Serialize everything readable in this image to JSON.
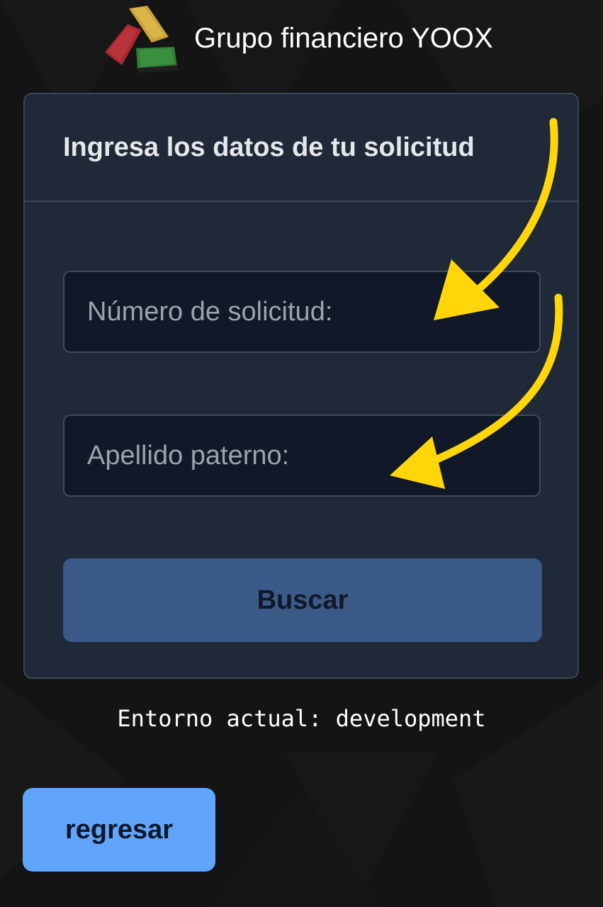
{
  "header": {
    "app_title": "Grupo financiero YOOX",
    "logo_icon": "stacked-bricks-logo-icon"
  },
  "form": {
    "title": "Ingresa los datos de tu solicitud",
    "request_number": {
      "placeholder": "Número de solicitud:",
      "value": ""
    },
    "last_name": {
      "placeholder": "Apellido paterno:",
      "value": ""
    },
    "search_label": "Buscar"
  },
  "footer": {
    "environment_text": "Entorno actual: development",
    "back_label": "regresar"
  },
  "annotations": {
    "arrow_color": "#ffd60a",
    "arrow_icon": "curved-arrow-icon"
  },
  "colors": {
    "background": "#141414",
    "card": "#1f2937",
    "input": "#111827",
    "search_button": "#3b5a87",
    "back_button": "#60a5fa"
  }
}
